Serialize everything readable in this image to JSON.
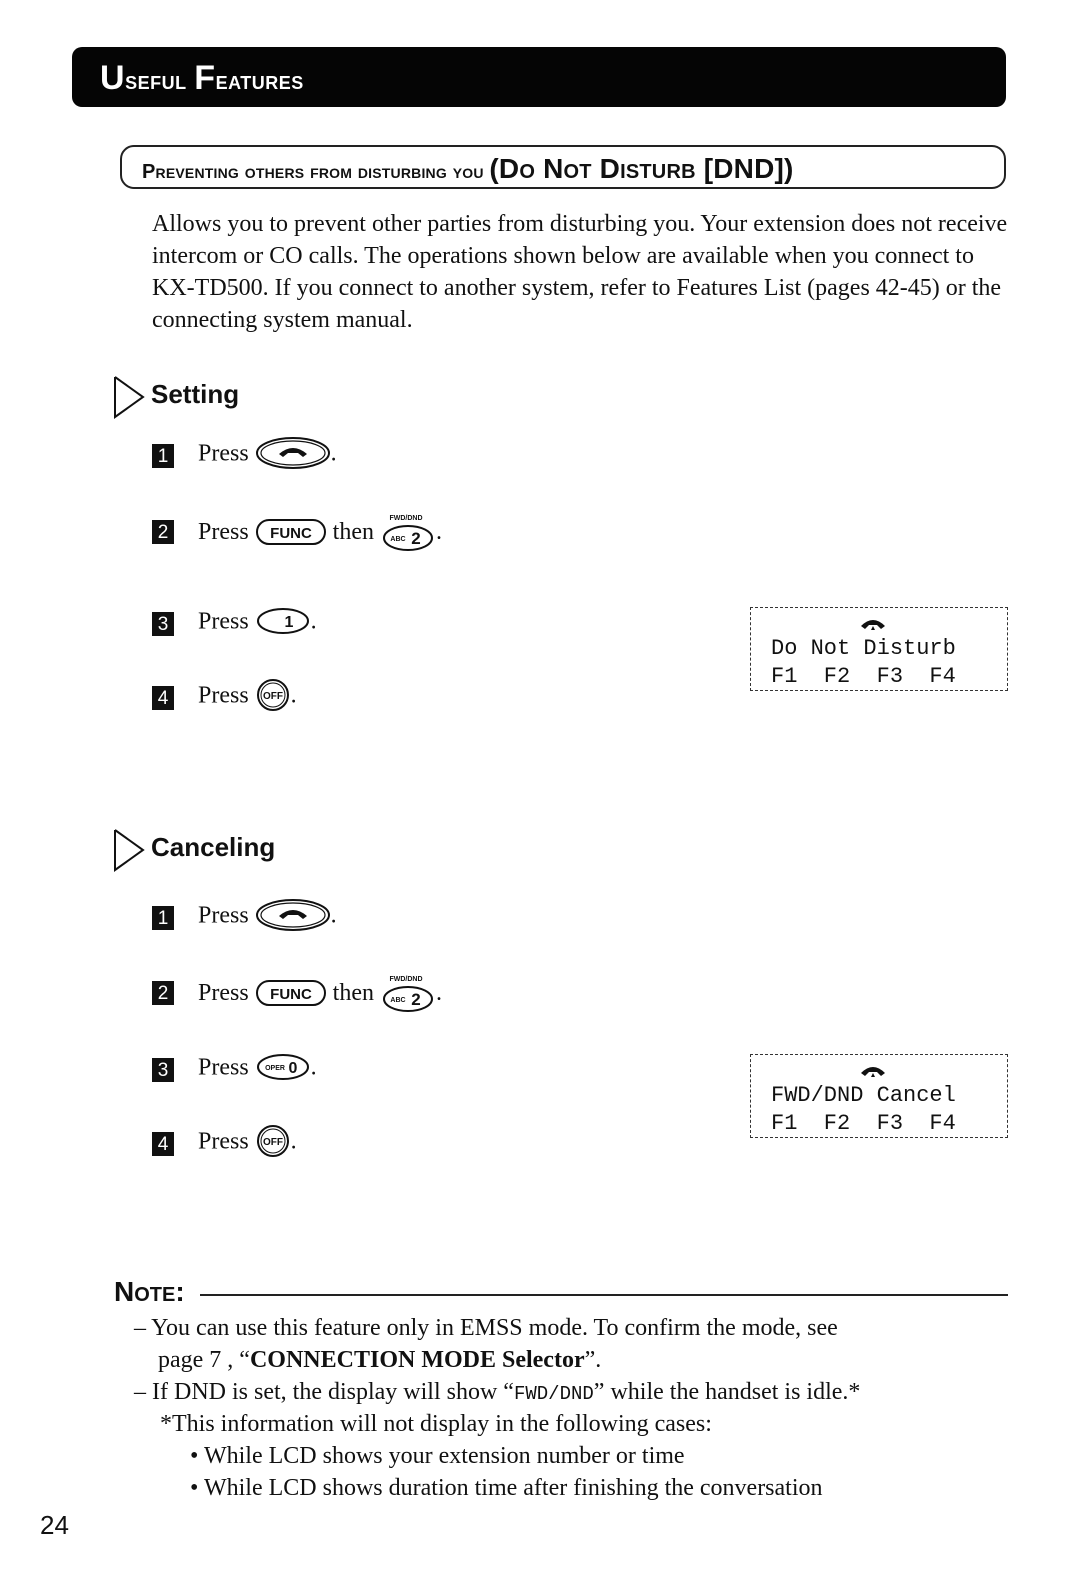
{
  "header": {
    "banner_title_first_cap": "U",
    "banner_title_first_rest": "seful ",
    "banner_title_second_cap": "F",
    "banner_title_second_rest": "eatures"
  },
  "section": {
    "title_main": "Preventing others from disturbing you ",
    "title_paren": "(Do Not Disturb [DND])"
  },
  "intro": "Allows you to prevent other parties from disturbing you. Your extension does not receive intercom or CO calls. The operations shown below are available when you connect to KX-TD500. If you connect to another system, refer to Features List (pages 42-45) or the connecting system manual.",
  "setting": {
    "heading": "Setting",
    "steps": [
      {
        "num": "1",
        "press": "Press",
        "key": "talk-key",
        "end": "."
      },
      {
        "num": "2",
        "press": "Press",
        "key": "FUNC",
        "then": "then",
        "key2_top": "FWD/DND",
        "key2_sub": "ABC",
        "key2_main": "2",
        "end": "."
      },
      {
        "num": "3",
        "press": "Press",
        "key": "1",
        "end": "."
      },
      {
        "num": "4",
        "press": "Press",
        "key": "OFF",
        "end": "."
      }
    ],
    "lcd": {
      "icon": "handset-icon",
      "line1": "Do Not Disturb",
      "line2": "F1  F2  F3  F4"
    }
  },
  "canceling": {
    "heading": "Canceling",
    "steps": [
      {
        "num": "1",
        "press": "Press",
        "key": "talk-key",
        "end": "."
      },
      {
        "num": "2",
        "press": "Press",
        "key": "FUNC",
        "then": "then",
        "key2_top": "FWD/DND",
        "key2_sub": "ABC",
        "key2_main": "2",
        "end": "."
      },
      {
        "num": "3",
        "press": "Press",
        "key_sub": "OPER",
        "key": "0",
        "end": "."
      },
      {
        "num": "4",
        "press": "Press",
        "key": "OFF",
        "end": "."
      }
    ],
    "lcd": {
      "icon": "handset-icon",
      "line1": "FWD/DND Cancel",
      "line2": "F1  F2  F3  F4"
    }
  },
  "note": {
    "heading": "Note:",
    "items": [
      {
        "dash": "–",
        "text": "You can use this feature only in EMSS mode. To confirm the mode, see"
      },
      {
        "text_a": "page 7 , “",
        "bold": "CONNECTION MODE Selector",
        "text_b": "”."
      },
      {
        "dash": "–",
        "text_a": "If DND is set, the display will show “",
        "mono": "FWD/DND",
        "text_b": "” while the handset is idle.*"
      },
      {
        "text": "*This information will not display in the following cases:"
      },
      {
        "bullet": "•",
        "text": "While LCD shows your extension number or time"
      },
      {
        "bullet": "•",
        "text": "While LCD shows duration time after finishing the conversation"
      }
    ]
  },
  "page_number": "24"
}
